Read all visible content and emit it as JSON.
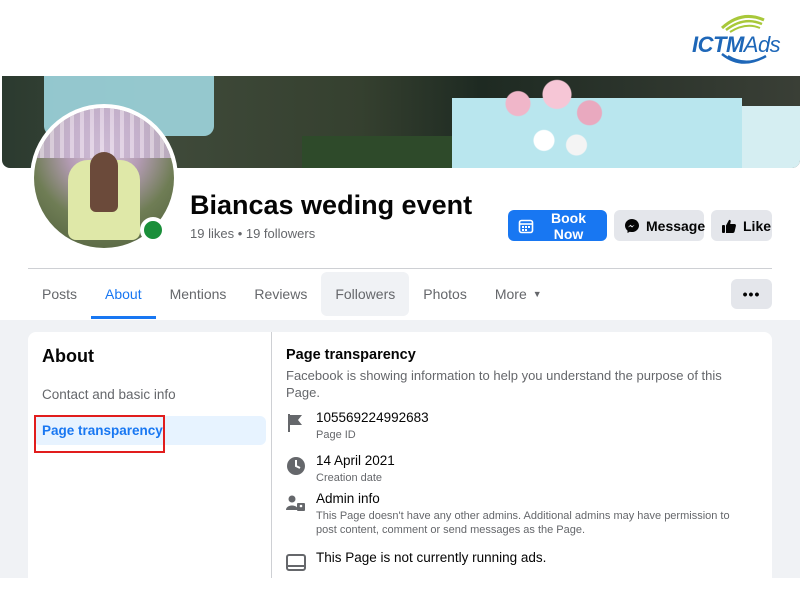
{
  "brand": {
    "part1": "ICTM",
    "part2": "Ads",
    "color": "#1e67b8",
    "accent": "#a8c83a"
  },
  "page": {
    "name": "Biancas weding event",
    "stats": "19 likes • 19 followers"
  },
  "actions": {
    "book": "Book Now",
    "message": "Message",
    "like": "Like"
  },
  "tabs": [
    {
      "label": "Posts"
    },
    {
      "label": "About"
    },
    {
      "label": "Mentions"
    },
    {
      "label": "Reviews"
    },
    {
      "label": "Followers"
    },
    {
      "label": "Photos"
    },
    {
      "label": "More"
    }
  ],
  "more_menu": "•••",
  "sidebar": {
    "title": "About",
    "items": [
      {
        "label": "Contact and basic info"
      },
      {
        "label": "Page transparency"
      }
    ]
  },
  "transparency": {
    "title": "Page transparency",
    "description": "Facebook is showing information to help you understand the purpose of this Page.",
    "page_id": "105569224992683",
    "page_id_label": "Page ID",
    "creation_date": "14 April 2021",
    "creation_date_label": "Creation date",
    "admin_title": "Admin info",
    "admin_text": "This Page doesn't have any other admins. Additional admins may have permission to post content, comment or send messages as the Page.",
    "ads_text": "This Page is not currently running ads."
  },
  "colors": {
    "primary": "#1877f2",
    "highlight": "#e11d1d",
    "online": "#1a8f3a"
  }
}
